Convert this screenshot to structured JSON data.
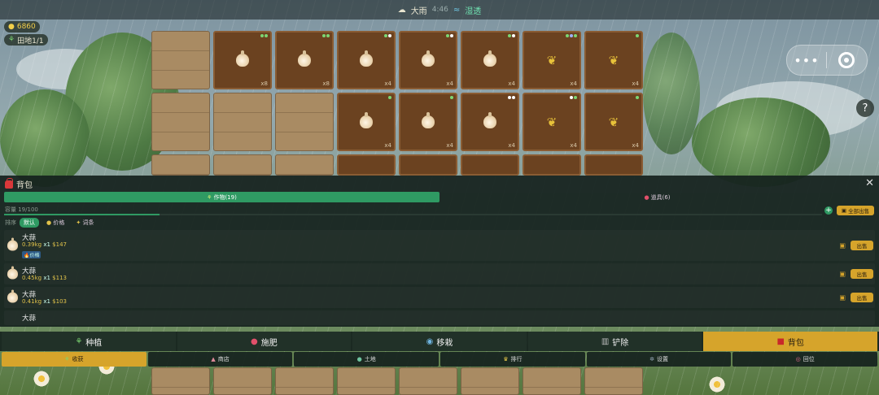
{
  "weather": {
    "icon": "rain-cloud-icon",
    "label": "大雨",
    "time": "4:46",
    "status_icon": "wave-icon",
    "status": "湿透"
  },
  "stats": {
    "gold": "6860",
    "plots": "田地1/1"
  },
  "capsule": {
    "more": "•••",
    "close_icon": "record-icon"
  },
  "help": "?",
  "farm": {
    "plots": [
      {
        "type": "empty"
      },
      {
        "type": "crop",
        "crop": "garlic",
        "qty": "x8",
        "dots": [
          "#7cd672",
          "#7cd672"
        ]
      },
      {
        "type": "crop",
        "crop": "garlic",
        "qty": "x8",
        "dots": [
          "#7cd672",
          "#7cd672"
        ]
      },
      {
        "type": "crop",
        "crop": "garlic",
        "qty": "x4",
        "dots": [
          "#7cd672",
          "#ffffff"
        ]
      },
      {
        "type": "crop",
        "crop": "garlic",
        "qty": "x4",
        "dots": [
          "#7cd672",
          "#ffffff"
        ]
      },
      {
        "type": "crop",
        "crop": "garlic",
        "qty": "x4",
        "dots": [
          "#7cd672",
          "#ffffff"
        ]
      },
      {
        "type": "crop",
        "crop": "wheat",
        "qty": "x4",
        "dots": [
          "#7cd672",
          "#9fb0ff",
          "#7cd672"
        ]
      },
      {
        "type": "crop",
        "crop": "wheat",
        "qty": "x4",
        "dots": [
          "#7cd672"
        ]
      },
      {
        "type": "empty"
      },
      {
        "type": "empty"
      },
      {
        "type": "empty"
      },
      {
        "type": "crop",
        "crop": "garlic",
        "qty": "x4",
        "dots": [
          "#7cd672"
        ]
      },
      {
        "type": "crop",
        "crop": "garlic",
        "qty": "x4",
        "dots": [
          "#7cd672"
        ]
      },
      {
        "type": "crop",
        "crop": "garlic",
        "qty": "x4",
        "dots": [
          "#ffffff",
          "#ffffff"
        ]
      },
      {
        "type": "crop",
        "crop": "wheat",
        "qty": "x4",
        "dots": [
          "#ffffff",
          "#7cd672"
        ]
      },
      {
        "type": "crop",
        "crop": "wheat",
        "qty": "x4",
        "dots": [
          "#7cd672"
        ]
      }
    ]
  },
  "backpack": {
    "title": "背包",
    "tabs": [
      {
        "label": "作物(19)",
        "icon": "sprout-icon"
      },
      {
        "label": "道具(6)",
        "icon": "potion-icon"
      }
    ],
    "capacity": "容量 19/100",
    "capacity_fraction": 0.19,
    "sell_all": "全部出售",
    "sort_label": "排序",
    "sort_options": [
      {
        "label": "默认"
      },
      {
        "label": "价格",
        "icon": "money-bag-icon"
      },
      {
        "label": "词条",
        "icon": "sparkle-icon"
      }
    ],
    "items": [
      {
        "name": "大蒜",
        "weight": "0.39kg",
        "count": "x1",
        "price": "$147",
        "badge": "🔥价格",
        "sell": "出售"
      },
      {
        "name": "大蒜",
        "weight": "0.45kg",
        "count": "x1",
        "price": "$113",
        "badge": "",
        "sell": "出售"
      },
      {
        "name": "大蒜",
        "weight": "0.41kg",
        "count": "x1",
        "price": "$103",
        "badge": "",
        "sell": "出售"
      },
      {
        "name": "大蒜",
        "weight": "",
        "count": "",
        "price": "",
        "badge": "",
        "sell": ""
      }
    ]
  },
  "actions": [
    {
      "label": "种植",
      "icon": "sprout-icon"
    },
    {
      "label": "施肥",
      "icon": "fertilizer-icon"
    },
    {
      "label": "移栽",
      "icon": "transplant-icon"
    },
    {
      "label": "铲除",
      "icon": "shovel-icon"
    },
    {
      "label": "背包",
      "icon": "backpack-icon",
      "active": true
    }
  ],
  "nav": [
    {
      "label": "收获",
      "icon": "harvest-icon",
      "active": true
    },
    {
      "label": "商店",
      "icon": "shop-icon"
    },
    {
      "label": "土地",
      "icon": "globe-icon"
    },
    {
      "label": "排行",
      "icon": "trophy-icon"
    },
    {
      "label": "设置",
      "icon": "gear-icon"
    },
    {
      "label": "回位",
      "icon": "target-icon"
    }
  ]
}
